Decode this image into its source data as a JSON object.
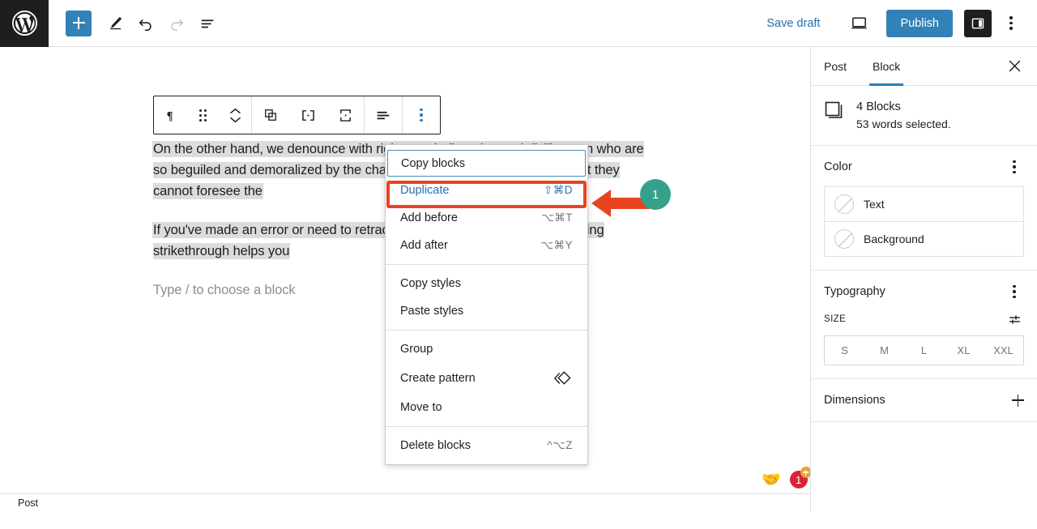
{
  "topbar": {
    "logo": "wordpress-logo",
    "tools": [
      {
        "name": "add-block-button",
        "icon": "plus-icon"
      },
      {
        "name": "tools-edit-button",
        "icon": "pencil-icon"
      },
      {
        "name": "undo-button",
        "icon": "undo-arrow-icon"
      },
      {
        "name": "redo-button",
        "icon": "redo-arrow-icon",
        "disabled": true
      },
      {
        "name": "list-view-button",
        "icon": "list-view-icon"
      }
    ],
    "save_draft_label": "Save draft",
    "publish_label": "Publish",
    "device_icon": "desktop-icon",
    "panel_toggle_icon": "sidebar-panel-icon",
    "more_icon": "vertical-ellipsis-icon",
    "accent_blue": "#3282b8",
    "link_blue": "#2271b1"
  },
  "block_toolbar": {
    "buttons": [
      {
        "name": "paragraph-block-type-button",
        "icon": "paragraph-pilcrow-icon"
      },
      {
        "name": "drag-handle-button",
        "icon": "drag-dots-icon"
      },
      {
        "name": "move-up-down-button",
        "icon": "chevron-up-down-icon"
      },
      {
        "name": "copy-blocks-button",
        "icon": "copy-squares-icon"
      },
      {
        "name": "split-button",
        "icon": "horizontal-split-icon"
      },
      {
        "name": "merge-button",
        "icon": "vertical-merge-icon"
      },
      {
        "name": "align-button",
        "icon": "align-left-icon"
      },
      {
        "name": "more-options-button",
        "icon": "vertical-ellipsis-icon"
      }
    ]
  },
  "content": {
    "paragraph1": "On the other hand, we denounce with righteous indignation and dislike men who are so beguiled and demoralized by the charms of pleasure of the moment that they cannot foresee the",
    "paragraph2": "If you've made an error or need to retract a statement in your blog post, using strikethrough helps you",
    "placeholder": "Type / to choose a block",
    "selection_highlight": "#dcdcdc"
  },
  "menu": {
    "sections": [
      {
        "items": [
          {
            "label": "Copy blocks",
            "shortcut": "",
            "state": "focused",
            "name": "menu-item-copy-blocks"
          },
          {
            "label": "Duplicate",
            "shortcut": "⇧⌘D",
            "state": "active",
            "name": "menu-item-duplicate"
          },
          {
            "label": "Add before",
            "shortcut": "⌥⌘T",
            "state": "",
            "name": "menu-item-add-before"
          },
          {
            "label": "Add after",
            "shortcut": "⌥⌘Y",
            "state": "",
            "name": "menu-item-add-after"
          }
        ]
      },
      {
        "items": [
          {
            "label": "Copy styles",
            "shortcut": "",
            "state": "",
            "name": "menu-item-copy-styles"
          },
          {
            "label": "Paste styles",
            "shortcut": "",
            "state": "",
            "name": "menu-item-paste-styles"
          }
        ]
      },
      {
        "items": [
          {
            "label": "Group",
            "shortcut": "",
            "state": "",
            "name": "menu-item-group"
          },
          {
            "label": "Create pattern",
            "shortcut": "",
            "state": "",
            "icon": "pattern-diamond-icon",
            "name": "menu-item-create-pattern"
          },
          {
            "label": "Move to",
            "shortcut": "",
            "state": "",
            "name": "menu-item-move-to"
          }
        ]
      },
      {
        "items": [
          {
            "label": "Delete blocks",
            "shortcut": "^⌥Z",
            "state": "",
            "name": "menu-item-delete-blocks"
          }
        ]
      }
    ]
  },
  "annotation": {
    "badge_number": "1",
    "box_color": "#e8441f",
    "arrow_color": "#e8441f",
    "badge_color": "#36a18b"
  },
  "sidebar": {
    "tabs": [
      {
        "label": "Post",
        "active": false,
        "name": "tab-post"
      },
      {
        "label": "Block",
        "active": true,
        "name": "tab-block"
      }
    ],
    "close_icon": "close-x-icon",
    "block_info": {
      "icon": "blocks-stack-icon",
      "title": "4 Blocks",
      "subtitle": "53 words selected."
    },
    "color": {
      "title": "Color",
      "more_icon": "vertical-ellipsis-icon",
      "rows": [
        {
          "label": "Text",
          "name": "color-row-text"
        },
        {
          "label": "Background",
          "name": "color-row-background"
        }
      ]
    },
    "typography": {
      "title": "Typography",
      "more_icon": "vertical-ellipsis-icon",
      "size_label": "SIZE",
      "settings_icon": "sliders-icon",
      "sizes": [
        "S",
        "M",
        "L",
        "XL",
        "XXL"
      ]
    },
    "dimensions": {
      "title": "Dimensions",
      "add_icon": "plus-icon"
    },
    "tab_active_color": "#2a7fb8"
  },
  "bottombar": {
    "breadcrumb": "Post"
  },
  "float_badges": {
    "handshake": "🤝",
    "count": "1"
  }
}
